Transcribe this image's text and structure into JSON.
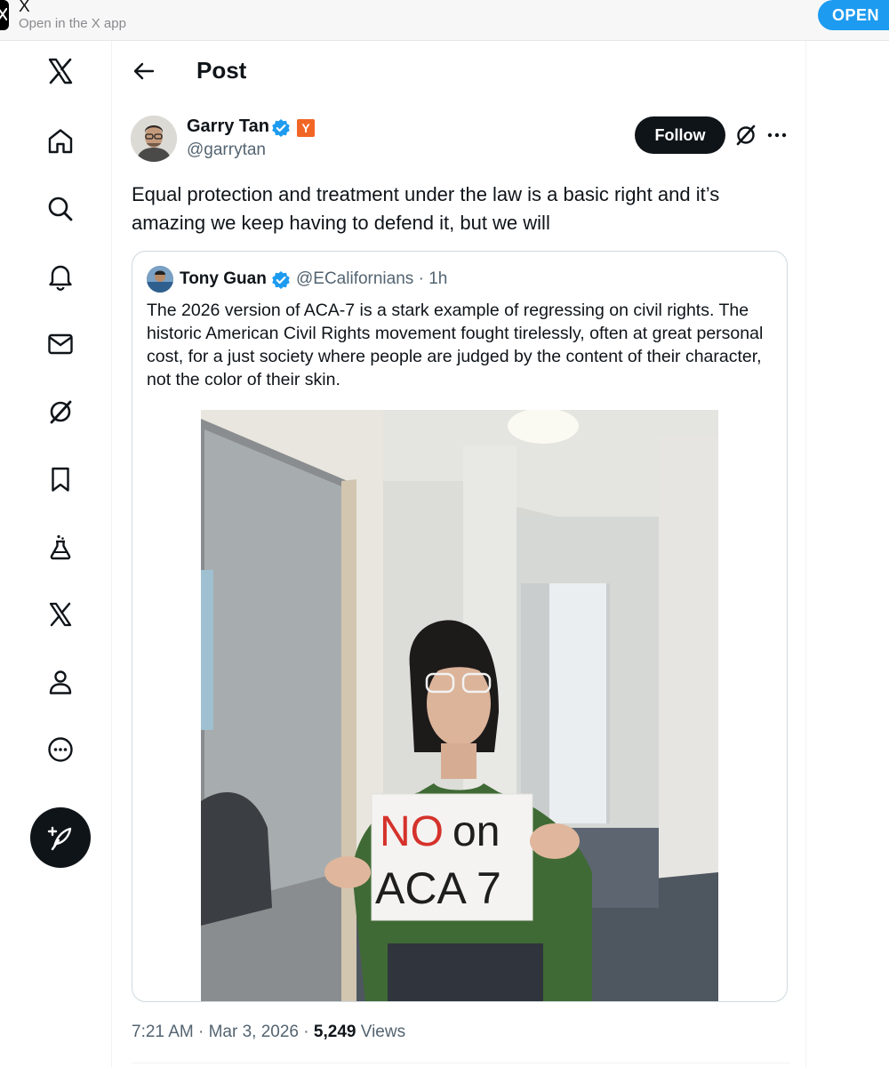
{
  "banner": {
    "app_name": "X",
    "subtitle": "Open in the X app",
    "open_label": "OPEN"
  },
  "sidebar": {
    "items": [
      {
        "icon": "x-logo-icon"
      },
      {
        "icon": "home-icon"
      },
      {
        "icon": "search-icon"
      },
      {
        "icon": "notifications-bell-icon"
      },
      {
        "icon": "messages-envelope-icon"
      },
      {
        "icon": "grok-icon"
      },
      {
        "icon": "bookmark-icon"
      },
      {
        "icon": "flask-icon"
      },
      {
        "icon": "x-premium-icon"
      },
      {
        "icon": "profile-icon"
      },
      {
        "icon": "more-circle-icon"
      }
    ],
    "compose_icon": "compose-feather-icon"
  },
  "header": {
    "title": "Post"
  },
  "post": {
    "author_name": "Garry Tan",
    "author_handle": "@garrytan",
    "yc_badge": "Y",
    "follow_label": "Follow",
    "text": "Equal protection and treatment under the law is a basic right and it’s amazing we keep having to defend it, but we will",
    "time": "7:21 AM",
    "date": "Mar 3, 2026",
    "views_count": "5,249",
    "views_label": "Views"
  },
  "quote": {
    "author_name": "Tony Guan",
    "author_handle": "@ECalifornians",
    "time_ago": "1h",
    "text": "The 2026 version of ACA-7 is a stark example of regressing on civil rights. The historic American Civil Rights movement fought tirelessly, often at great personal cost, for a just society where people are judged by the content of their character, not the color of their skin.",
    "sign_line1_no": "NO",
    "sign_line1_on": "on",
    "sign_line2": "ACA 7"
  },
  "colors": {
    "verified": "#1d9bf0",
    "yc_orange": "#f26625",
    "open_button": "#1d9bf0",
    "sign_red": "#d5322b"
  }
}
